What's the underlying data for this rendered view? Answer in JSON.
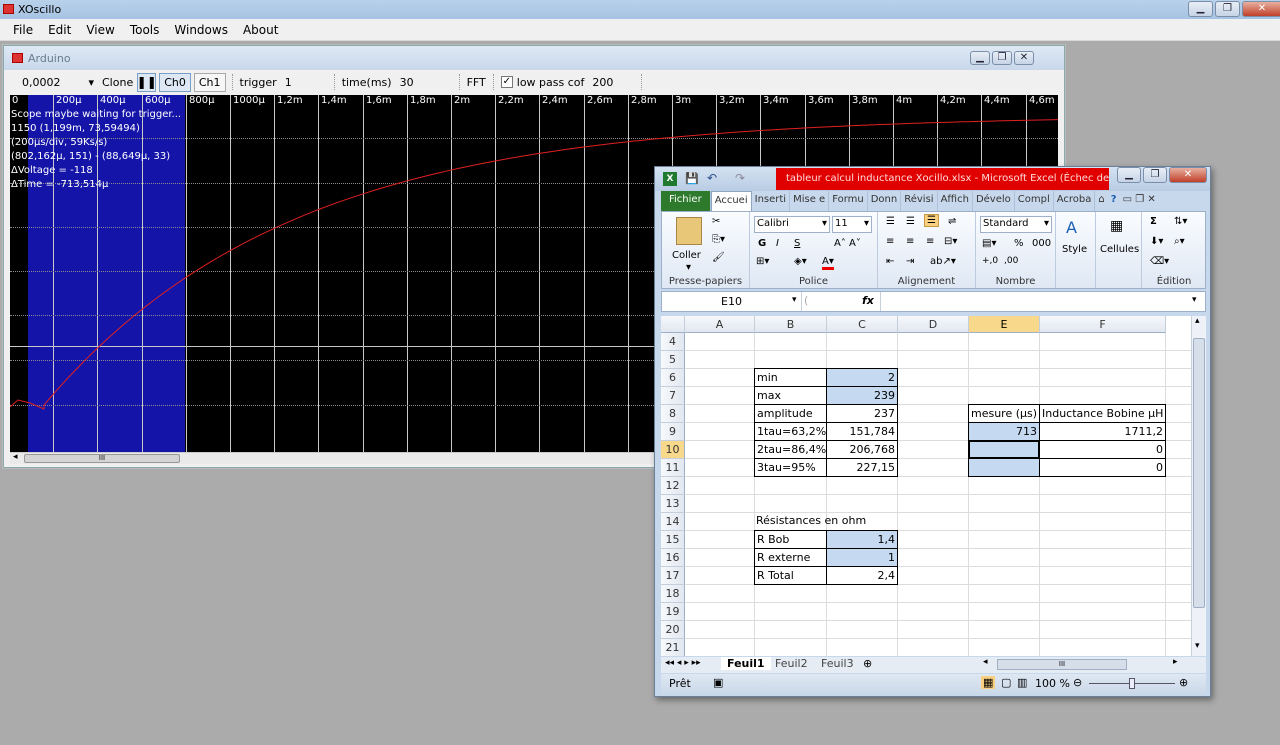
{
  "app": {
    "title": "XOscillo",
    "menu": [
      "File",
      "Edit",
      "View",
      "Tools",
      "Windows",
      "About"
    ]
  },
  "arduino": {
    "title": "Arduino",
    "toolbar": {
      "scale_value": "0,0002",
      "clone": "Clone",
      "pause_icon": "pause-icon",
      "ch0": "Ch0",
      "ch1": "Ch1",
      "trigger_label": "trigger",
      "trigger_value": "1",
      "time_label": "time(ms)",
      "time_value": "30",
      "fft": "FFT",
      "lowpass_label": "low pass cof",
      "lowpass_value": "200",
      "lowpass_checked": true
    },
    "scope": {
      "ticks": [
        "0",
        "200µ",
        "400µ",
        "600µ",
        "800µ",
        "1000µ",
        "1,2m",
        "1,4m",
        "1,6m",
        "1,8m",
        "2m",
        "2,2m",
        "2,4m",
        "2,6m",
        "2,8m",
        "3m",
        "3,2m",
        "3,4m",
        "3,6m",
        "3,8m",
        "4m",
        "4,2m",
        "4,4m",
        "4,6m"
      ],
      "info": [
        "Scope maybe waiting for trigger...",
        "1150 (1,199m, 73,59494)",
        "(200µs/div, 59Ks/s)",
        "(802,162µ, 151) - (88,649µ, 33)",
        "ΔVoltage = -118",
        "ΔTime = -713,514µ"
      ],
      "trace_color": "#e02020",
      "selection_color": "#1414a8"
    },
    "scroll_thumb": "III"
  },
  "excel": {
    "title": "tableur calcul inductance Xocillo.xlsx - Microsoft Excel (Échec de...",
    "tabs": [
      "Fichier",
      "Accuei",
      "Inserti",
      "Mise e",
      "Formu",
      "Donn",
      "Révisi",
      "Affich",
      "Dévelo",
      "Compl",
      "Acroba"
    ],
    "ribbon": {
      "paste": "Coller",
      "clipboard_group": "Presse-papiers",
      "font_name": "Calibri",
      "font_size": "11",
      "bold": "G",
      "italic": "I",
      "underline": "S",
      "font_group": "Police",
      "align_group": "Alignement",
      "number_format": "Standard",
      "number_group": "Nombre",
      "percent": "%",
      "thousands": "000",
      "style": "Style",
      "cells": "Cellules",
      "edit_group": "Édition",
      "sigma": "Σ"
    },
    "name_box": "E10",
    "fx": "fx",
    "columns": [
      "A",
      "B",
      "C",
      "D",
      "E",
      "F"
    ],
    "rows": [
      "4",
      "5",
      "6",
      "7",
      "8",
      "9",
      "10",
      "11",
      "12",
      "13",
      "14",
      "15",
      "16",
      "17",
      "18",
      "19",
      "20",
      "21"
    ],
    "cells": {
      "b6": "min",
      "c6": "2",
      "b7": "max",
      "c7": "239",
      "b8": "amplitude",
      "c8": "237",
      "b9": "1tau=63,2%",
      "c9": "151,784",
      "b10": "2tau=86,4%",
      "c10": "206,768",
      "b11": "3tau=95%",
      "c11": "227,15",
      "e8": "mesure (µs)",
      "f8": "Inductance Bobine µH",
      "e9": "713",
      "f9": "1711,2",
      "f10": "0",
      "f11": "0",
      "b14": "Résistances en ohm",
      "b15": "R Bob",
      "c15": "1,4",
      "b16": "R externe",
      "c16": "1",
      "b17": "R Total",
      "c17": "2,4"
    },
    "sheets": [
      "Feuil1",
      "Feuil2",
      "Feuil3"
    ],
    "status": "Prêt",
    "zoom": "100 %",
    "hscroll_thumb": "III"
  }
}
